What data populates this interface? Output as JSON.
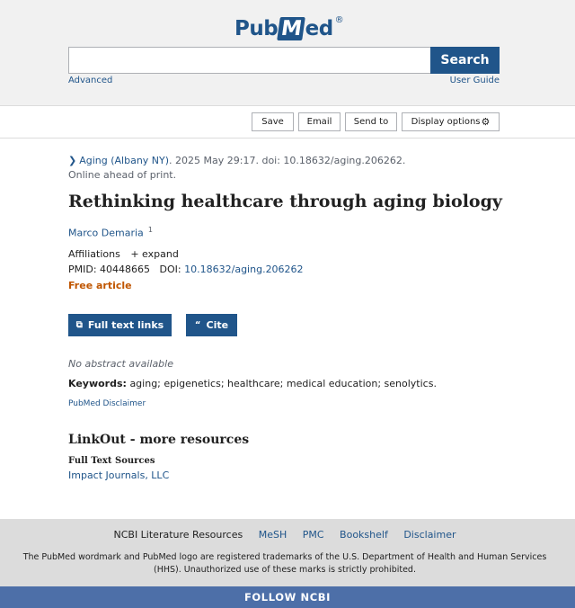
{
  "header": {
    "logo_pub": "Pub",
    "logo_m": "M",
    "logo_ed": "ed",
    "logo_reg": "®",
    "search_value": "",
    "search_label": "Search",
    "advanced": "Advanced",
    "user_guide": "User Guide"
  },
  "actions": {
    "save": "Save",
    "email": "Email",
    "send_to": "Send to",
    "display_options": "Display options"
  },
  "article": {
    "journal": "Aging (Albany NY)",
    "citation_rest": ". 2025 May 29:17. doi: 10.18632/aging.206262.",
    "status": "Online ahead of print.",
    "title": "Rethinking healthcare through aging biology",
    "author": "Marco Demaria",
    "author_sup": "1",
    "affiliations_label": "Affiliations",
    "expand_label": "expand",
    "pmid_label": "PMID:",
    "pmid": "40448665",
    "doi_label": "DOI:",
    "doi": "10.18632/aging.206262",
    "free": "Free article",
    "full_text_links": "Full text links",
    "cite": "Cite",
    "no_abstract": "No abstract available",
    "keywords_label": "Keywords:",
    "keywords": "aging; epigenetics; healthcare; medical education; senolytics.",
    "disclaimer": "PubMed Disclaimer"
  },
  "linkout": {
    "heading": "LinkOut - more resources",
    "full_text_sources": "Full Text Sources",
    "impact": "Impact Journals, LLC"
  },
  "footer": {
    "ncbi_lit": "NCBI Literature Resources",
    "links": [
      "MeSH",
      "PMC",
      "Bookshelf",
      "Disclaimer"
    ],
    "trademark": "The PubMed wordmark and PubMed logo are registered trademarks of the U.S. Department of Health and Human Services (HHS). Unauthorized use of these marks is strictly prohibited.",
    "follow": "FOLLOW NCBI"
  },
  "colors": {
    "brand": "#20558a",
    "free_article": "#c05600",
    "follow_bar": "#4d6fa8"
  },
  "icons": {
    "gear": "gear-icon",
    "chevron": "chevron-right-icon",
    "external": "external-link-icon",
    "quote": "quote-icon"
  }
}
